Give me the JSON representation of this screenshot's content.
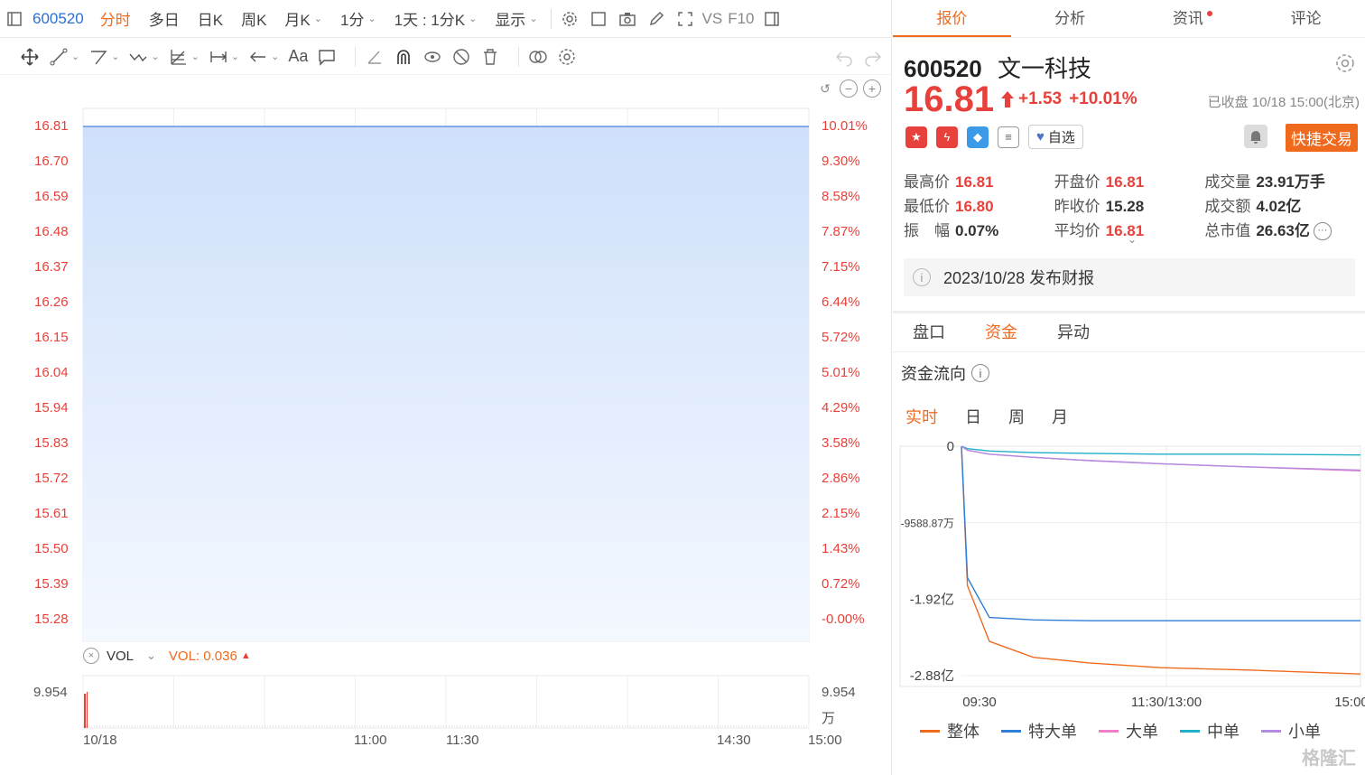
{
  "topbar": {
    "code": "600520",
    "tabs": [
      "分时",
      "多日",
      "日K",
      "周K",
      "月K"
    ],
    "interval": "1分",
    "range": "1天 : 1分K",
    "display": "显示",
    "vs_label": "VS",
    "f10_label": "F10"
  },
  "y_axis": {
    "prices": [
      "16.81",
      "16.70",
      "16.59",
      "16.48",
      "16.37",
      "16.26",
      "16.15",
      "16.04",
      "15.94",
      "15.83",
      "15.72",
      "15.61",
      "15.50",
      "15.39",
      "15.28"
    ],
    "percents": [
      "10.01%",
      "9.30%",
      "8.58%",
      "7.87%",
      "7.15%",
      "6.44%",
      "5.72%",
      "5.01%",
      "4.29%",
      "3.58%",
      "2.86%",
      "2.15%",
      "1.43%",
      "0.72%",
      "-0.00%"
    ]
  },
  "volume": {
    "label": "VOL",
    "value_label": "VOL: 0.036",
    "max_left": "9.954",
    "max_right": "9.954",
    "unit": "万"
  },
  "x_axis": [
    "10/18",
    "11:00",
    "11:30",
    "14:30",
    "15:00"
  ],
  "right_tabs": [
    "报价",
    "分析",
    "资讯",
    "评论"
  ],
  "stock": {
    "code": "600520",
    "name": "文一科技",
    "price": "16.81",
    "change": "+1.53",
    "change_pct": "+10.01%",
    "status": "已收盘 10/18 15:00(北京)",
    "fav_label": "自选",
    "quick_trade": "快捷交易"
  },
  "stats": [
    [
      {
        "k": "最高价",
        "v": "16.81",
        "red": true
      },
      {
        "k": "开盘价",
        "v": "16.81",
        "red": true
      },
      {
        "k": "成交量",
        "v": "23.91万手",
        "red": false
      }
    ],
    [
      {
        "k": "最低价",
        "v": "16.80",
        "red": true
      },
      {
        "k": "昨收价",
        "v": "15.28",
        "red": false
      },
      {
        "k": "成交额",
        "v": "4.02亿",
        "red": false
      }
    ],
    [
      {
        "k": "振　幅",
        "v": "0.07%",
        "red": false
      },
      {
        "k": "平均价",
        "v": "16.81",
        "red": true
      },
      {
        "k": "总市值",
        "v": "26.63亿",
        "red": false
      }
    ]
  ],
  "notice": "2023/10/28  发布财报",
  "subtabs": [
    "盘口",
    "资金",
    "异动"
  ],
  "flow": {
    "title": "资金流向",
    "periods": [
      "实时",
      "日",
      "周",
      "月"
    ],
    "y_labels": [
      "0",
      "-9588.87万",
      "-1.92亿",
      "-2.88亿"
    ],
    "x_labels": [
      "09:30",
      "11:30/13:00",
      "15:00"
    ],
    "legend": [
      {
        "name": "整体",
        "color": "#f06a1e"
      },
      {
        "name": "特大单",
        "color": "#2f7fd8"
      },
      {
        "name": "大单",
        "color": "#f07ec8"
      },
      {
        "name": "中单",
        "color": "#1fb0c8"
      },
      {
        "name": "小单",
        "color": "#b38be0"
      }
    ]
  },
  "chart_data": [
    {
      "type": "area",
      "x": [
        "09:30",
        "15:00"
      ],
      "series": [
        {
          "values": [
            16.81,
            16.81
          ]
        }
      ],
      "ylim": [
        15.28,
        16.81
      ]
    },
    {
      "type": "line",
      "x": [
        "09:30",
        "09:35",
        "09:45",
        "10:00",
        "10:30",
        "11:30/13:00",
        "14:00",
        "15:00"
      ],
      "ylim": [
        -2.88,
        0
      ],
      "ylabel_unit": "亿",
      "series": [
        {
          "name": "整体",
          "values": [
            0,
            -1.75,
            -2.45,
            -2.65,
            -2.72,
            -2.78,
            -2.81,
            -2.86
          ]
        },
        {
          "name": "特大单",
          "values": [
            0,
            -1.65,
            -2.15,
            -2.18,
            -2.19,
            -2.19,
            -2.19,
            -2.19
          ]
        },
        {
          "name": "大单",
          "values": [
            0,
            -0.05,
            -0.1,
            -0.14,
            -0.18,
            -0.22,
            -0.26,
            -0.31
          ]
        },
        {
          "name": "中单",
          "values": [
            0,
            -0.03,
            -0.06,
            -0.08,
            -0.09,
            -0.1,
            -0.1,
            -0.11
          ]
        },
        {
          "name": "小单",
          "values": [
            0,
            -0.05,
            -0.1,
            -0.14,
            -0.18,
            -0.22,
            -0.26,
            -0.3
          ]
        }
      ]
    }
  ]
}
